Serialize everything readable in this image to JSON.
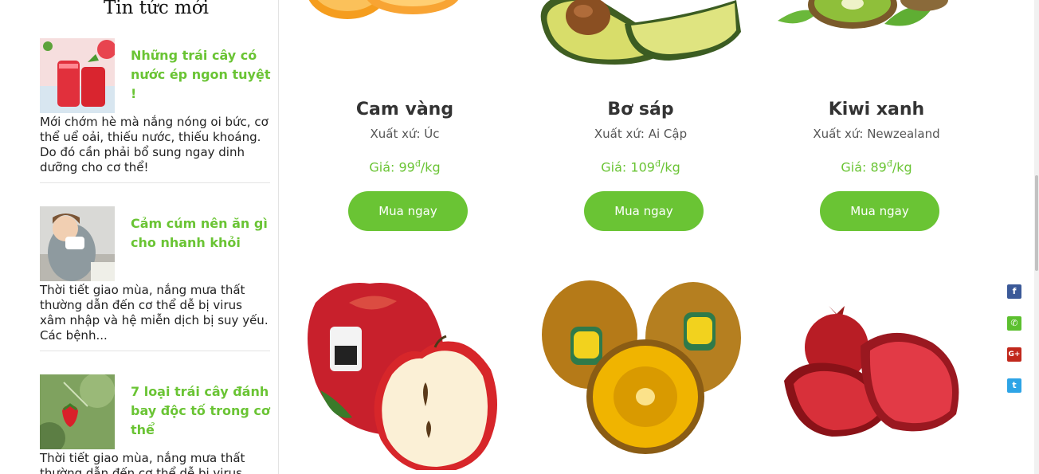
{
  "sidebar": {
    "title": "Tin tức mới",
    "news": [
      {
        "title": "Những trái cây có nước ép ngon tuyệt !",
        "excerpt": "Mới chớm hè mà nắng nóng oi bức, cơ thể uể oải, thiếu nước, thiếu khoáng. Do đó cần phải bổ sung ngay dinh dưỡng cho cơ thể!"
      },
      {
        "title": "Cảm cúm nên ăn gì cho nhanh khỏi",
        "excerpt": "Thời tiết giao mùa, nắng mưa thất thường dẫn đến cơ thể dễ bị virus xâm nhập và hệ miễn dịch bị suy yếu. Các bệnh..."
      },
      {
        "title": "7 loại trái cây đánh bay độc tố trong cơ thể",
        "excerpt": "Thời tiết giao mùa, nắng mưa thất thường dẫn đến cơ thể dễ bị virus"
      }
    ]
  },
  "products": [
    {
      "name": "Cam vàng",
      "origin": "Xuất xứ: Úc",
      "price_prefix": "Giá: ",
      "price_value": "99",
      "currency": "đ",
      "unit": "/kg",
      "button": "Mua ngay"
    },
    {
      "name": "Bơ sáp",
      "origin": "Xuất xứ: Ai Cập",
      "price_prefix": "Giá: ",
      "price_value": "109",
      "currency": "đ",
      "unit": "/kg",
      "button": "Mua ngay"
    },
    {
      "name": "Kiwi xanh",
      "origin": "Xuất xứ: Newzealand",
      "price_prefix": "Giá: ",
      "price_value": "89",
      "currency": "đ",
      "unit": "/kg",
      "button": "Mua ngay"
    }
  ],
  "colors": {
    "accent": "#6ac434",
    "facebook": "#3b5998",
    "phone": "#5cc02f",
    "google_plus": "#c1281c",
    "twitter": "#2da4e6"
  }
}
